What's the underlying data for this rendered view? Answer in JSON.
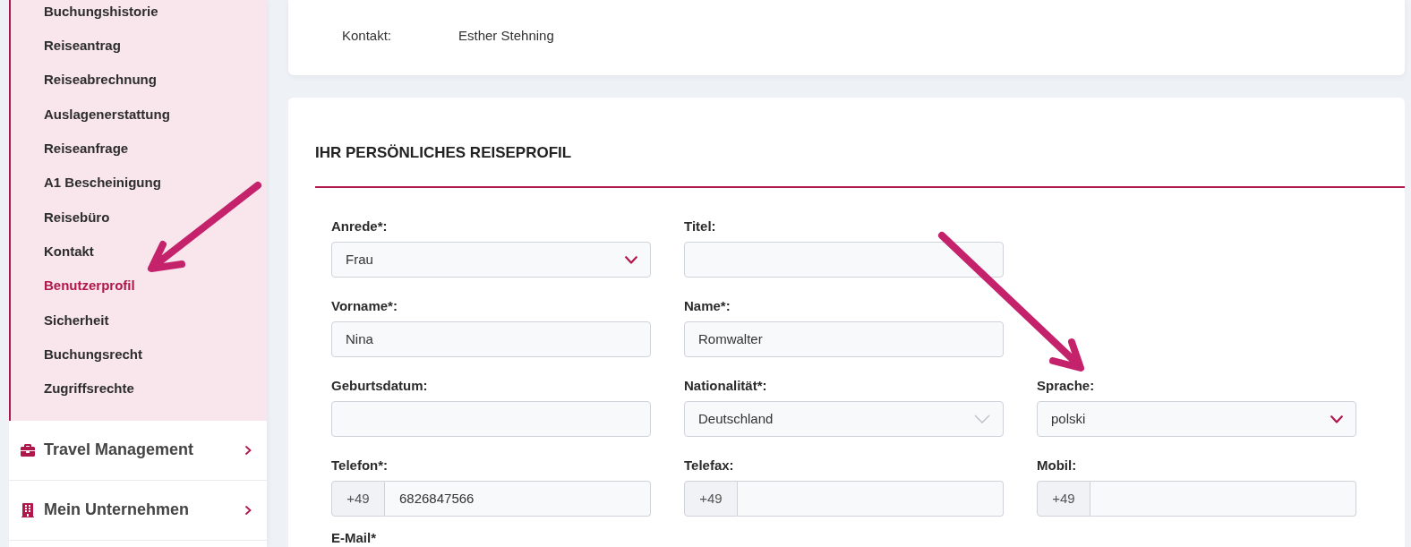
{
  "sidebar": {
    "submenu": [
      {
        "label": "Buchungshistorie",
        "selected": false
      },
      {
        "label": "Reiseantrag",
        "selected": false
      },
      {
        "label": "Reiseabrechnung",
        "selected": false
      },
      {
        "label": "Auslagenerstattung",
        "selected": false
      },
      {
        "label": "Reiseanfrage",
        "selected": false
      },
      {
        "label": "A1 Bescheinigung",
        "selected": false
      },
      {
        "label": "Reisebüro",
        "selected": false
      },
      {
        "label": "Kontakt",
        "selected": false
      },
      {
        "label": "Benutzerprofil",
        "selected": true
      },
      {
        "label": "Sicherheit",
        "selected": false
      },
      {
        "label": "Buchungsrecht",
        "selected": false
      },
      {
        "label": "Zugriffsrechte",
        "selected": false
      }
    ],
    "sections": [
      {
        "label": "Travel Management",
        "expanded": false
      },
      {
        "label": "Mein Unternehmen",
        "expanded": false
      }
    ]
  },
  "contact_card": {
    "label": "Kontakt:",
    "value": "Esther Stehning"
  },
  "profile_form": {
    "title": "IHR PERSÖNLICHES REISEPROFIL",
    "rows": [
      [
        {
          "label": "Anrede*:",
          "input": {
            "kind": "select",
            "value": "Frau",
            "disabled": false
          }
        },
        {
          "label": "Titel:",
          "input": {
            "kind": "text"
          }
        }
      ],
      [
        {
          "label": "Vorname*:",
          "input": {
            "kind": "text",
            "value": "Nina"
          }
        },
        {
          "label": "Name*:",
          "input": {
            "kind": "text",
            "value": "Romwalter"
          }
        }
      ],
      [
        {
          "label": "Geburtsdatum:",
          "input": {
            "kind": "text"
          }
        },
        {
          "label": "Nationalität*:",
          "input": {
            "kind": "select",
            "value": "Deutschland",
            "disabled": true
          }
        },
        {
          "label": "Sprache:",
          "input": {
            "kind": "select",
            "value": "polski",
            "disabled": false
          }
        }
      ],
      [
        {
          "label": "Telefon*:",
          "input": {
            "kind": "phone",
            "prefix": "+49",
            "value": "6826847566"
          }
        },
        {
          "label": "Telefax:",
          "input": {
            "kind": "phone",
            "prefix": "+49"
          }
        },
        {
          "label": "Mobil:",
          "input": {
            "kind": "phone",
            "prefix": "+49"
          }
        }
      ],
      [
        {
          "label": "E-Mail*"
        }
      ]
    ]
  }
}
